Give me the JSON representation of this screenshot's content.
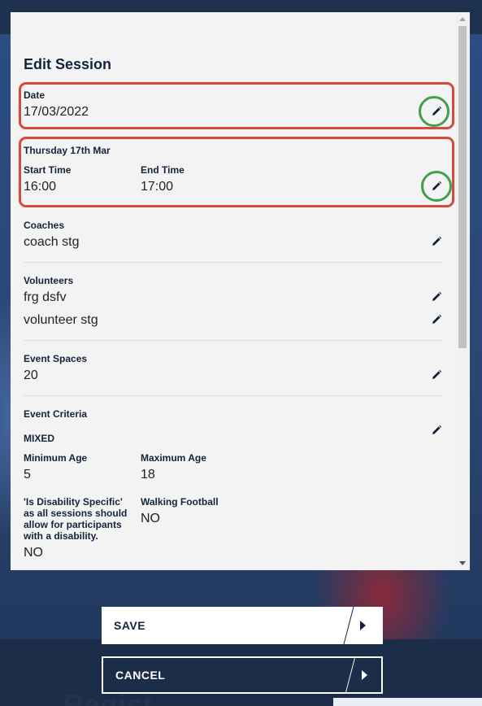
{
  "modal": {
    "title": "Edit Session",
    "date": {
      "label": "Date",
      "value": "17/03/2022"
    },
    "time": {
      "day_heading": "Thursday 17th Mar",
      "start_label": "Start Time",
      "start_value": "16:00",
      "end_label": "End Time",
      "end_value": "17:00"
    },
    "coaches": {
      "label": "Coaches",
      "items": [
        "coach stg"
      ]
    },
    "volunteers": {
      "label": "Volunteers",
      "items": [
        "frg dsfv",
        "volunteer stg"
      ]
    },
    "event_spaces": {
      "label": "Event Spaces",
      "value": "20"
    },
    "event_criteria": {
      "label": "Event Criteria",
      "gender": "MIXED",
      "min_age_label": "Minimum Age",
      "min_age_value": "5",
      "max_age_label": "Maximum Age",
      "max_age_value": "18",
      "disability_label": "'Is Disability Specific' as all sessions should allow for participants with a disability.",
      "disability_value": "NO",
      "walking_label": "Walking Football",
      "walking_value": "NO"
    }
  },
  "actions": {
    "save_label": "SAVE",
    "cancel_label": "CANCEL"
  },
  "background": {
    "heading_fragment": "Regist"
  },
  "icons": {
    "edit": "pencil-icon",
    "next": "arrow-right-icon"
  },
  "colors": {
    "highlight_red": "#d9493a",
    "highlight_green": "#3f9f4d",
    "text_dark": "#14233c",
    "background_navy": "#1f3350"
  }
}
